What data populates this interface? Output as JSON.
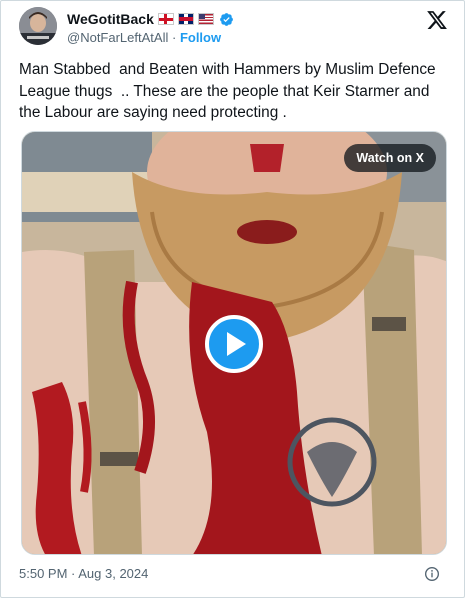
{
  "author": {
    "display_name": "WeGotitBack",
    "handle": "@NotFarLeftAtAll",
    "separator": "·",
    "follow_label": "Follow",
    "flags": [
      "england-flag",
      "uk-flag",
      "us-flag"
    ],
    "verified_icon": "verified-badge-icon"
  },
  "tweet": {
    "text": "Man Stabbed  and Beaten with Hammers by Muslim Defence League thugs  .. These are the people that Keir Starmer and the Labour are saying need protecting ."
  },
  "media": {
    "watch_label": "Watch on X",
    "play_icon": "play-icon"
  },
  "footer": {
    "timestamp": "5:50 PM · Aug 3, 2024",
    "info_icon": "info-icon"
  },
  "colors": {
    "accent": "#1d9bf0",
    "text": "#0f1419",
    "muted": "#536471",
    "border": "#cfd9de"
  }
}
